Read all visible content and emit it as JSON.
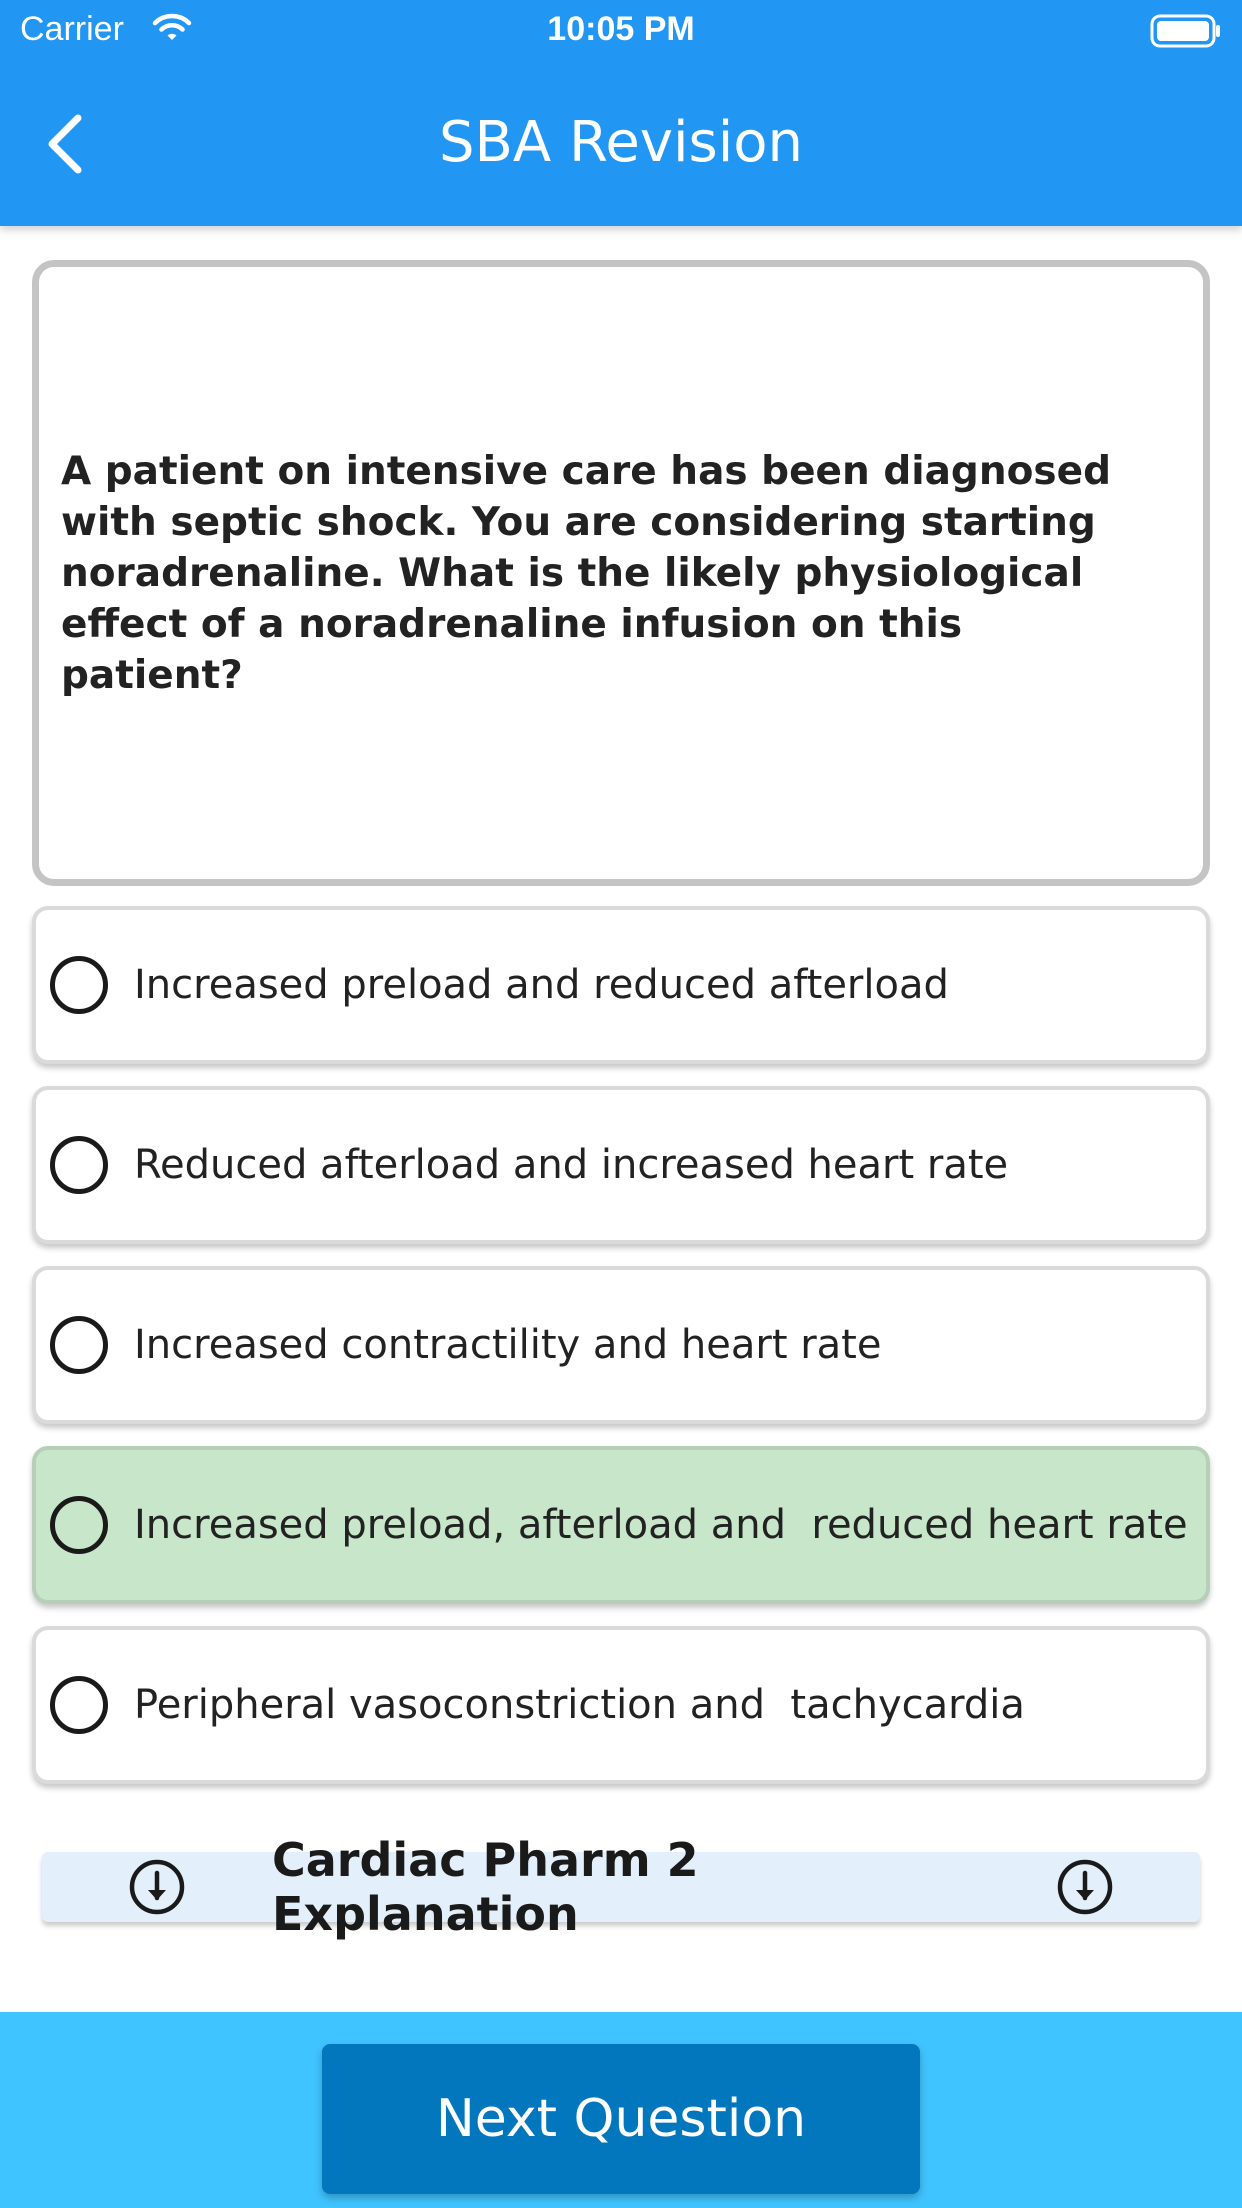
{
  "status_bar": {
    "carrier": "Carrier",
    "time": "10:05 PM"
  },
  "nav": {
    "title": "SBA Revision",
    "back_icon": "chevron-left-icon"
  },
  "question": {
    "text": "A patient on intensive care has been diagnosed with septic shock. You are considering starting noradrenaline. What is the likely physiological effect of a noradrenaline infusion on this patient?"
  },
  "options": [
    {
      "label": "Increased preload and reduced afterload",
      "correct": false
    },
    {
      "label": "Reduced afterload and increased heart rate",
      "correct": false
    },
    {
      "label": "Increased contractility and heart rate",
      "correct": false
    },
    {
      "label": "Increased preload, afterload and  reduced heart rate",
      "correct": true
    },
    {
      "label": "Peripheral vasoconstriction and  tachycardia",
      "correct": false
    }
  ],
  "explanation": {
    "label": "Cardiac Pharm 2 Explanation",
    "icon": "arrow-down-circle-icon"
  },
  "footer": {
    "next_label": "Next Question"
  },
  "colors": {
    "nav_bar": "#2196f3",
    "correct_answer": "#c8e6c9",
    "explanation_bg": "#e3f0fc",
    "footer_bg": "#40c4ff",
    "next_button": "#0277bd"
  }
}
